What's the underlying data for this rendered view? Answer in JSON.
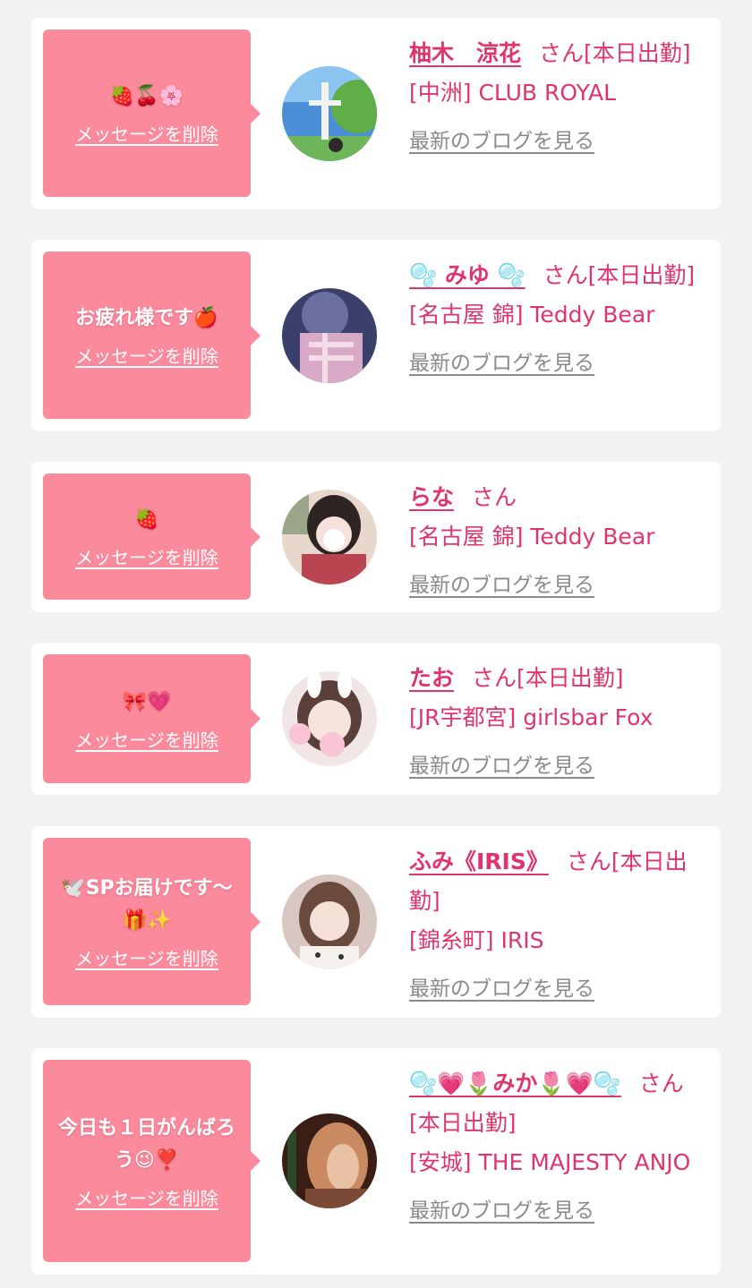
{
  "entries": [
    {
      "message": "🍓🍒🌸",
      "delete_label": "メッセージを削除",
      "name": "柚木　涼花",
      "suffix": "さん[本日出勤]",
      "shop": "[中洲] CLUB ROYAL",
      "blog_label": "最新のブログを見る",
      "avatar_colors": [
        "#4a8fd8",
        "#5fae48"
      ]
    },
    {
      "message": "お疲れ様です🍎",
      "delete_label": "メッセージを削除",
      "name": "🫧 みゆ 🫧",
      "suffix": "さん[本日出勤]",
      "shop": "[名古屋 錦] Teddy Bear",
      "blog_label": "最新のブログを見る",
      "avatar_colors": [
        "#3b3f6b",
        "#d9a9c8"
      ]
    },
    {
      "message": "🍓",
      "delete_label": "メッセージを削除",
      "name": "らな",
      "suffix": "さん",
      "shop": "[名古屋 錦] Teddy Bear",
      "blog_label": "最新のブログを見る",
      "avatar_colors": [
        "#e8d8cc",
        "#b84550"
      ]
    },
    {
      "message": "🎀💗",
      "delete_label": "メッセージを削除",
      "name": "たお",
      "suffix": "さん[本日出勤]",
      "shop": "[JR宇都宮] girlsbar Fox",
      "blog_label": "最新のブログを見る",
      "avatar_colors": [
        "#f1e6e6",
        "#5a4038"
      ]
    },
    {
      "message": "🕊️SPお届けです〜🎁✨",
      "delete_label": "メッセージを削除",
      "name": "ふみ《IRIS》",
      "suffix": "さん[本日出勤]",
      "shop": "[錦糸町] IRIS",
      "blog_label": "最新のブログを見る",
      "avatar_colors": [
        "#d8c6c0",
        "#6b4a3e"
      ]
    },
    {
      "message": "今日も１日がんばろう😉❣️",
      "delete_label": "メッセージを削除",
      "name": "🫧💗🌷みか🌷💗🫧",
      "suffix": "さん[本日出勤]",
      "shop": "[安城] THE MAJESTY ANJO",
      "blog_label": "最新のブログを見る",
      "avatar_colors": [
        "#3a1e16",
        "#c98a62"
      ]
    }
  ]
}
